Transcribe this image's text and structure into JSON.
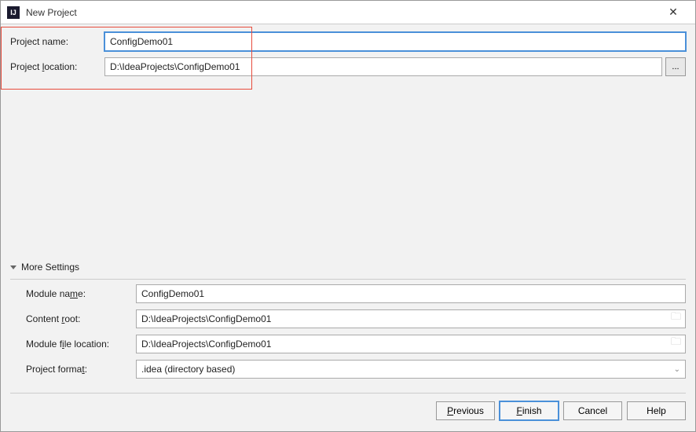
{
  "window": {
    "title": "New Project",
    "icon_label": "IJ"
  },
  "top": {
    "project_name_label": "Project name:",
    "project_name_value": "ConfigDemo01",
    "project_location_label_pre": "Project ",
    "project_location_label_mn": "l",
    "project_location_label_post": "ocation:",
    "project_location_value": "D:\\IdeaProjects\\ConfigDemo01",
    "browse_label": "..."
  },
  "more": {
    "header": "More Settings",
    "module_name_label_pre": "Module na",
    "module_name_label_mn": "m",
    "module_name_label_post": "e:",
    "module_name_value": "ConfigDemo01",
    "content_root_label_pre": "Content ",
    "content_root_label_mn": "r",
    "content_root_label_post": "oot:",
    "content_root_value": "D:\\IdeaProjects\\ConfigDemo01",
    "module_file_label_pre": "Module f",
    "module_file_label_mn": "i",
    "module_file_label_post": "le location:",
    "module_file_value": "D:\\IdeaProjects\\ConfigDemo01",
    "project_format_label_pre": "Project forma",
    "project_format_label_mn": "t",
    "project_format_label_post": ":",
    "project_format_value": ".idea (directory based)"
  },
  "buttons": {
    "previous_mn": "P",
    "previous_post": "revious",
    "finish_mn": "F",
    "finish_post": "inish",
    "cancel": "Cancel",
    "help": "Help"
  }
}
